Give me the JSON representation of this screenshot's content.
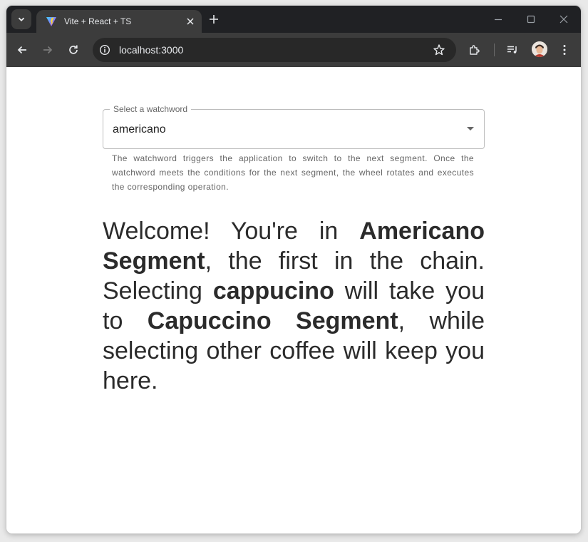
{
  "browser": {
    "tab_title": "Vite + React + TS",
    "url": "localhost:3000"
  },
  "page": {
    "select": {
      "label": "Select a watchword",
      "value": "americano"
    },
    "helper_text": "The watchword triggers the application to switch to the next segment. Once the watchword meets the conditions for the next segment, the wheel rotates and executes the corresponding operation.",
    "message": {
      "part1": "Welcome! You're in ",
      "segment_name": "Americano Segment",
      "part2": ", the first in the chain. Selecting ",
      "keyword": "cappucino",
      "part3": " will take you to ",
      "next_segment": "Capuccino Segment",
      "part4": ", while selecting other coffee will keep you here."
    }
  },
  "colors": {
    "tab_strip": "#202124",
    "toolbar": "#3c3c3c",
    "text": "#2b2b2b"
  }
}
